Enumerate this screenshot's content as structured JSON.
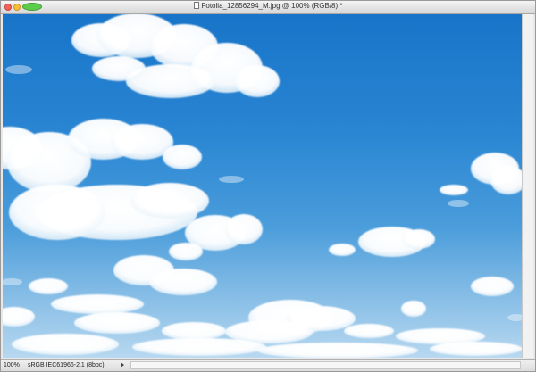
{
  "window": {
    "title": "Fotolia_12856294_M.jpg @ 100% (RGB/8) *"
  },
  "icons": {
    "close": "close-icon",
    "minimize": "minimize-icon",
    "zoom": "zoom-icon",
    "document": "document-icon",
    "menu_arrow": "chevron-right-icon"
  },
  "canvas": {
    "subject": "blue sky with clouds"
  },
  "status": {
    "zoom_value": "100%",
    "document_info": "sRGB IEC61966-2.1 (8bpc)"
  }
}
